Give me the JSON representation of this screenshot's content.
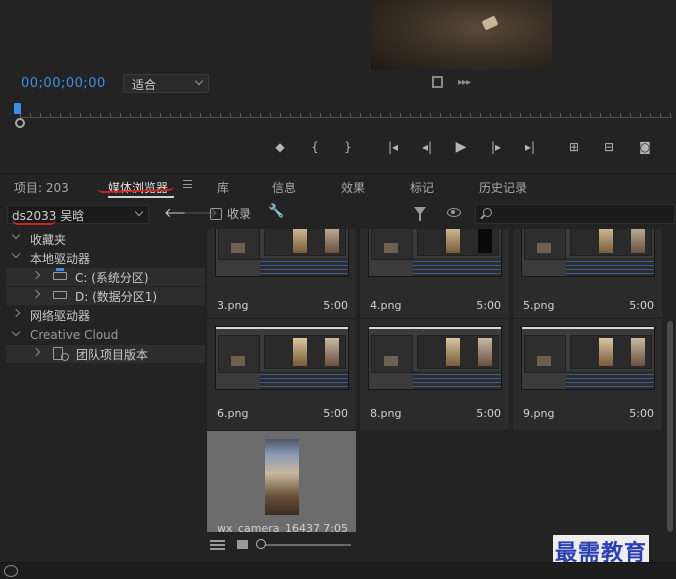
{
  "monitor": {
    "timecode": "00;00;00;00",
    "fit_value": "适合"
  },
  "transport": {
    "icons": [
      "add-marker-icon",
      "mark-in-icon",
      "mark-out-icon",
      "go-to-in-icon",
      "step-back-icon",
      "play-icon",
      "step-forward-icon",
      "go-to-out-icon",
      "lift-icon",
      "extract-icon",
      "export-frame-icon"
    ]
  },
  "tabs": [
    {
      "label": "项目: 203"
    },
    {
      "label": "媒体浏览器"
    },
    {
      "label": "库"
    },
    {
      "label": "信息"
    },
    {
      "label": "效果"
    },
    {
      "label": "标记"
    },
    {
      "label": "历史记录"
    }
  ],
  "toolbar": {
    "location": "ds2033 吴晗",
    "favorite_label": "收录",
    "search_placeholder": ""
  },
  "tree": {
    "favorites": "收藏夹",
    "local_drives": "本地驱动器",
    "drive_c": "C: (系统分区)",
    "drive_d": "D: (数据分区1)",
    "network_drives": "网络驱动器",
    "creative_cloud": "Creative Cloud",
    "team_projects": "团队项目版本"
  },
  "grid": {
    "items": [
      {
        "name": "3.png",
        "duration": "5:00"
      },
      {
        "name": "4.png",
        "duration": "5:00"
      },
      {
        "name": "5.png",
        "duration": "5:00"
      },
      {
        "name": "6.png",
        "duration": "5:00"
      },
      {
        "name": "8.png",
        "duration": "5:00"
      },
      {
        "name": "9.png",
        "duration": "5:00"
      },
      {
        "name": "wx_camera_16437",
        "duration": "7:05"
      }
    ]
  },
  "watermark": "最需教育",
  "colors": {
    "accent": "#3d8ee8",
    "annotation_red": "#d42323",
    "watermark_blue": "#2a3fb0"
  }
}
